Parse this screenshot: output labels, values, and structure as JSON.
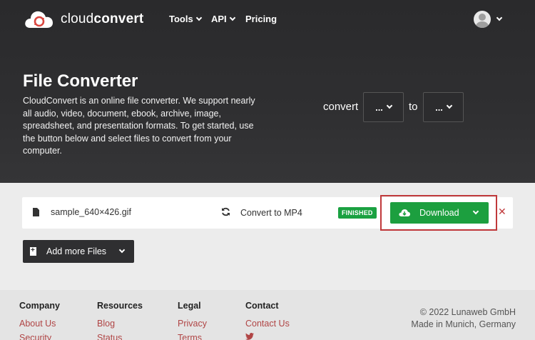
{
  "brand": {
    "name_light": "cloud",
    "name_bold": "convert"
  },
  "nav": {
    "items": [
      {
        "label": "Tools",
        "has_dropdown": true
      },
      {
        "label": "API",
        "has_dropdown": true
      },
      {
        "label": "Pricing",
        "has_dropdown": false
      }
    ]
  },
  "hero": {
    "title": "File Converter",
    "description": "CloudConvert is an online file converter. We support nearly all audio, video, document, ebook, archive, image, spreadsheet, and presentation formats. To get started, use the button below and select files to convert from your computer.",
    "convert_label": "convert",
    "to_label": "to",
    "from_select_value": "...",
    "to_select_value": "..."
  },
  "file": {
    "name": "sample_640×426.gif",
    "conversion": "Convert to MP4",
    "status": "FINISHED",
    "download_label": "Download"
  },
  "add_files": {
    "label": "Add more Files"
  },
  "footer": {
    "columns": [
      {
        "heading": "Company",
        "links": [
          "About Us",
          "Security"
        ]
      },
      {
        "heading": "Resources",
        "links": [
          "Blog",
          "Status"
        ]
      },
      {
        "heading": "Legal",
        "links": [
          "Privacy",
          "Terms"
        ]
      },
      {
        "heading": "Contact",
        "links": [
          "Contact Us"
        ]
      }
    ],
    "copyright": "© 2022 Lunaweb GmbH",
    "location": "Made in Munich, Germany"
  },
  "colors": {
    "hero_bg": "#2f2f31",
    "success": "#1c9f3f",
    "danger": "#c0393b",
    "link": "#b04545",
    "logo_red": "#d9463f"
  },
  "icons": [
    "cloud-logo-icon",
    "chevron-down-icon",
    "user-avatar-icon",
    "file-icon",
    "sync-icon",
    "cloud-download-icon",
    "close-icon",
    "add-file-icon",
    "twitter-icon"
  ]
}
